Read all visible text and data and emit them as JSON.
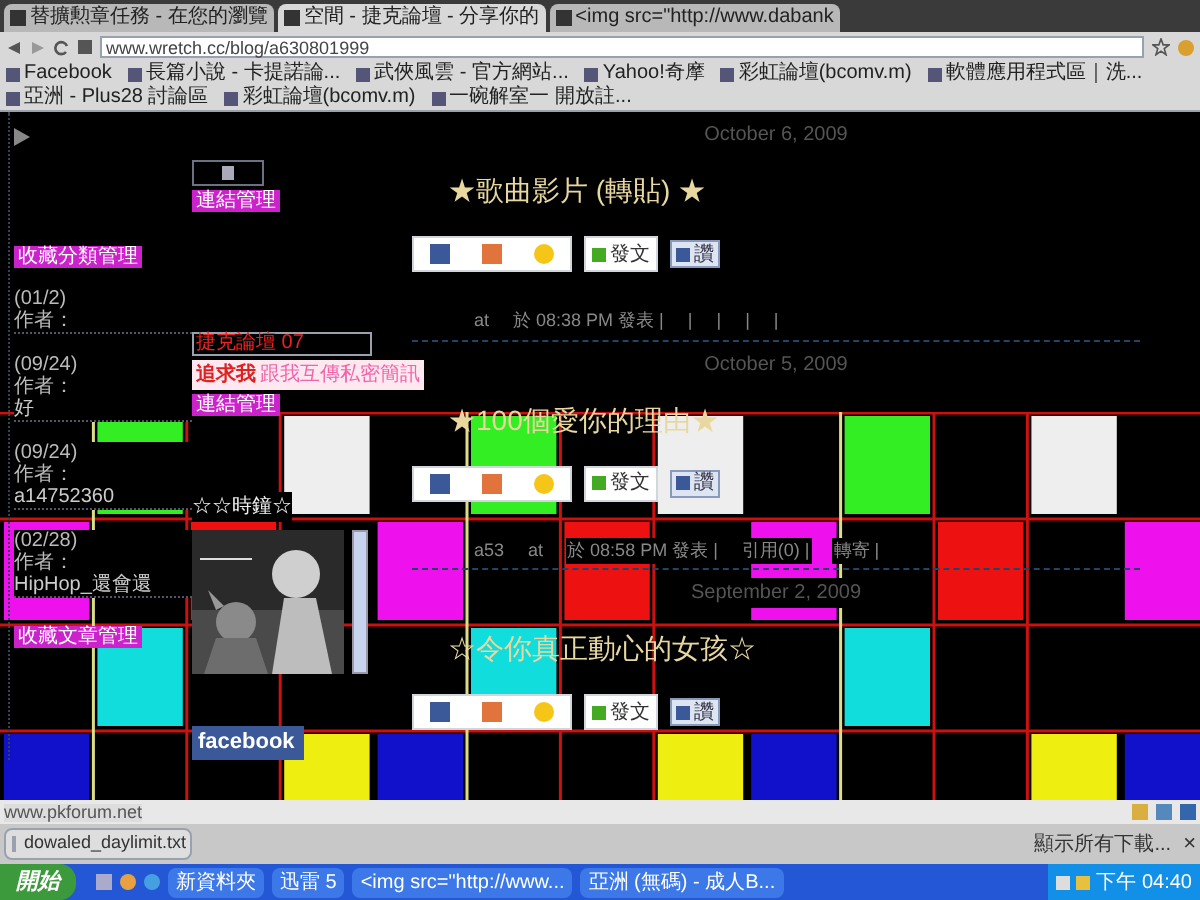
{
  "tabs": [
    {
      "label": "替擴勲章任務 - 在您的瀏覽",
      "selected": false
    },
    {
      "label": "空間 - 捷克論壇 - 分享你的",
      "selected": true
    },
    {
      "label": "<img src=\"http://www.dabank",
      "selected": false
    }
  ],
  "address": "www.wretch.cc/blog/a630801999",
  "bookmarks": [
    "Facebook",
    "長篇小說 - 卡提諾論...",
    "武俠風雲 - 官方網站...",
    "Yahoo!奇摩",
    "彩虹論壇(bcomv.m)",
    "軟體應用程式區｜洗...",
    "亞洲 - Plus28 討論區",
    "彩虹論壇(bcomv.m)",
    "一碗解室一 開放註..."
  ],
  "sidebar": {
    "top_button": "收藏分類管理",
    "entries": [
      {
        "date": "(01/2)",
        "author": "作者："
      },
      {
        "date": "(09/24)",
        "author": "作者：",
        "text": "好"
      },
      {
        "date": "(09/24)",
        "author": "作者：",
        "text": "a14752360"
      },
      {
        "date": "(02/28)",
        "author": "作者：",
        "text": "HipHop_還會還"
      }
    ],
    "bottom_button": "收藏文章管理"
  },
  "middle": {
    "link_button": "連結管理",
    "search_value": "捷克論壇 07",
    "banner_title": "追求我",
    "banner_text": "跟我互傳私密簡訊",
    "link_button_2": "連結管理",
    "clock_title": "☆☆時鐘☆",
    "facebook": "facebook"
  },
  "posts": [
    {
      "date": "October 6, 2009",
      "title": "★歌曲影片 (轉貼) ★",
      "share_post": "發文",
      "share_like": "讚",
      "meta": [
        "at",
        "於 08:38 PM 發表 |",
        "|",
        "|",
        "|",
        "|"
      ]
    },
    {
      "date": "October 5, 2009",
      "title": "★100個愛你的理由★",
      "share_post": "發文",
      "share_like": "讚",
      "meta": [
        "a53",
        "at",
        "於 08:58 PM 發表 |",
        "引用(0) |",
        "轉寄 |"
      ]
    },
    {
      "date": "September 2, 2009",
      "title": "☆令你真正動心的女孩☆",
      "share_post": "發文",
      "share_like": "讚"
    }
  ],
  "status_url": "www.pkforum.net",
  "download": {
    "file": "dowaled_daylimit.txt",
    "show_all": "顯示所有下載...",
    "close": "×"
  },
  "taskbar": {
    "start": "開始",
    "items": [
      "新資料夾",
      "迅雷 5",
      "<img src=\"http://www...",
      "亞洲 (無碼) - 成人B..."
    ],
    "clock": "下午 04:40"
  }
}
